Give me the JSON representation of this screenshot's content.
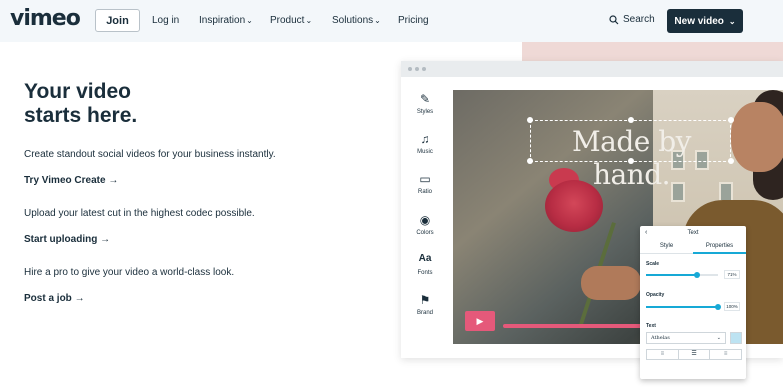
{
  "header": {
    "logo": "vimeo",
    "join": "Join",
    "login": "Log in",
    "nav": [
      {
        "label": "Inspiration",
        "dropdown": true
      },
      {
        "label": "Product",
        "dropdown": true
      },
      {
        "label": "Solutions",
        "dropdown": true
      },
      {
        "label": "Pricing",
        "dropdown": false
      }
    ],
    "search": "Search",
    "new_video": "New video"
  },
  "hero": {
    "title_line1": "Your video",
    "title_line2": "starts here.",
    "blocks": [
      {
        "text": "Create standout social videos for your business instantly.",
        "cta": "Try Vimeo Create"
      },
      {
        "text": "Upload your latest cut in the highest codec possible.",
        "cta": "Start uploading"
      },
      {
        "text": "Hire a pro to give your video a world-class look.",
        "cta": "Post a job"
      }
    ]
  },
  "editor": {
    "tools": [
      {
        "label": "Styles",
        "icon": "magic-wand-icon"
      },
      {
        "label": "Music",
        "icon": "music-note-icon"
      },
      {
        "label": "Ratio",
        "icon": "ratio-icon"
      },
      {
        "label": "Colors",
        "icon": "palette-icon"
      },
      {
        "label": "Fonts",
        "icon": "font-icon"
      },
      {
        "label": "Brand",
        "icon": "brand-icon"
      }
    ],
    "overlay_text": "Made by hand.",
    "panel": {
      "title": "Text",
      "tabs": [
        "Style",
        "Properties"
      ],
      "active_tab": "Properties",
      "scale_label": "Scale",
      "scale_value": "71%",
      "scale_level": 0.71,
      "opacity_label": "Opacity",
      "opacity_value": "100%",
      "opacity_level": 1.0,
      "text_label": "Text",
      "font": "Athelas",
      "alignment": "center"
    },
    "colors": {
      "accent": "#17a9d6",
      "play": "#e5597a",
      "brand": "#1a2e3b"
    }
  }
}
